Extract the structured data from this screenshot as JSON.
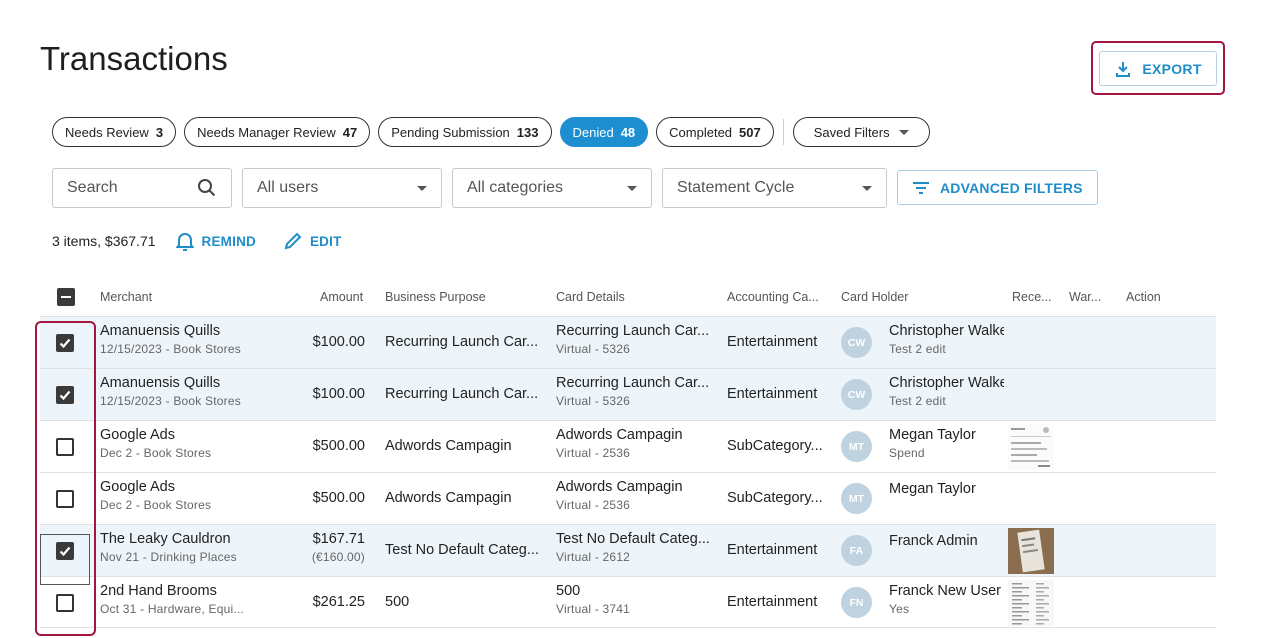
{
  "page": {
    "title": "Transactions"
  },
  "header": {
    "export_label": "EXPORT"
  },
  "chips": [
    {
      "label": "Needs Review",
      "count": "3",
      "active": false
    },
    {
      "label": "Needs Manager Review",
      "count": "47",
      "active": false
    },
    {
      "label": "Pending Submission",
      "count": "133",
      "active": false
    },
    {
      "label": "Denied",
      "count": "48",
      "active": true
    },
    {
      "label": "Completed",
      "count": "507",
      "active": false
    }
  ],
  "saved_filters": {
    "label": "Saved Filters"
  },
  "filters": {
    "search_placeholder": "Search",
    "users": "All users",
    "categories": "All categories",
    "cycle": "Statement Cycle",
    "advanced_label": "ADVANCED FILTERS"
  },
  "summary": {
    "text": "3 items, $367.71",
    "remind_label": "REMIND",
    "edit_label": "EDIT"
  },
  "table": {
    "headers": {
      "merchant": "Merchant",
      "amount": "Amount",
      "business_purpose": "Business Purpose",
      "card_details": "Card Details",
      "accounting": "Accounting Ca...",
      "card_holder": "Card Holder",
      "receipt": "Rece...",
      "warning": "War...",
      "action": "Action"
    },
    "rows": [
      {
        "checked": true,
        "selected": true,
        "merchant": "Amanuensis Quills",
        "merchant_sub": "12/15/2023 - Book Stores",
        "amount": "$100.00",
        "amount_sub": "",
        "purpose": "Recurring Launch Car...",
        "card": "Recurring Launch Car...",
        "card_sub": "Virtual - 5326",
        "accounting": "Entertainment",
        "initials": "CW",
        "holder": "Christopher Walke",
        "holder_sub": "Test 2 edit",
        "receipt": false
      },
      {
        "checked": true,
        "selected": true,
        "merchant": "Amanuensis Quills",
        "merchant_sub": "12/15/2023 - Book Stores",
        "amount": "$100.00",
        "amount_sub": "",
        "purpose": "Recurring Launch Car...",
        "card": "Recurring Launch Car...",
        "card_sub": "Virtual - 5326",
        "accounting": "Entertainment",
        "initials": "CW",
        "holder": "Christopher Walke",
        "holder_sub": "Test 2 edit",
        "receipt": false
      },
      {
        "checked": false,
        "selected": false,
        "merchant": "Google Ads",
        "merchant_sub": "Dec 2 - Book Stores",
        "amount": "$500.00",
        "amount_sub": "",
        "purpose": "Adwords Campagin",
        "card": "Adwords Campagin",
        "card_sub": "Virtual - 2536",
        "accounting": "SubCategory...",
        "initials": "MT",
        "holder": "Megan Taylor",
        "holder_sub": "Spend",
        "receipt": "document"
      },
      {
        "checked": false,
        "selected": false,
        "merchant": "Google Ads",
        "merchant_sub": "Dec 2 - Book Stores",
        "amount": "$500.00",
        "amount_sub": "",
        "purpose": "Adwords Campagin",
        "card": "Adwords Campagin",
        "card_sub": "Virtual - 2536",
        "accounting": "SubCategory...",
        "initials": "MT",
        "holder": "Megan Taylor",
        "holder_sub": "",
        "receipt": false
      },
      {
        "checked": true,
        "selected": true,
        "merchant": "The Leaky Cauldron",
        "merchant_sub": "Nov 21 - Drinking Places",
        "amount": "$167.71",
        "amount_sub": "(€160.00)",
        "purpose": "Test No Default Categ...",
        "card": "Test No Default Categ...",
        "card_sub": "Virtual - 2612",
        "accounting": "Entertainment",
        "initials": "FA",
        "holder": "Franck Admin",
        "holder_sub": "",
        "receipt": "photo"
      },
      {
        "checked": false,
        "selected": false,
        "merchant": "2nd Hand Brooms",
        "merchant_sub": "Oct 31 - Hardware, Equi...",
        "amount": "$261.25",
        "amount_sub": "",
        "purpose": "500",
        "card": "500",
        "card_sub": "Virtual - 3741",
        "accounting": "Entertainment",
        "initials": "FN",
        "holder": "Franck New User",
        "holder_sub": "Yes",
        "receipt": "list"
      }
    ]
  },
  "colors": {
    "accent": "#1d8ed0",
    "highlight": "#a3163d",
    "selected_row": "#eef5fa",
    "avatar": "#bfd2df"
  },
  "icons": {
    "export": "download-icon",
    "search": "search-icon",
    "filter": "filter-lines-icon",
    "remind": "bell-icon",
    "edit": "pencil-icon",
    "check": "check-icon"
  }
}
